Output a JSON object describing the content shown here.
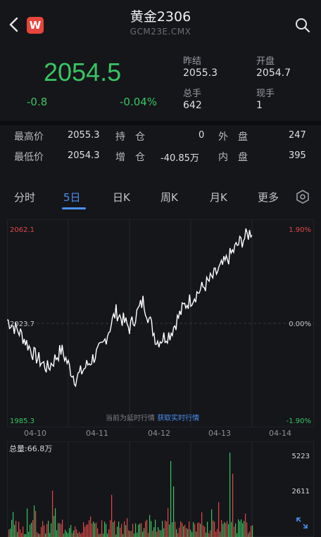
{
  "header": {
    "title": "黄金2306",
    "subtitle": "GCM23E.CMX",
    "logo_text": "W",
    "back_icon": "chevron-left-icon",
    "search_icon": "search-icon"
  },
  "quote": {
    "price": "2054.5",
    "change": "-0.8",
    "change_pct": "-0.04%",
    "prev_settle_label": "昨结",
    "prev_settle": "2055.3",
    "open_label": "开盘",
    "open": "2054.7",
    "total_vol_label": "总手",
    "total_vol": "642",
    "current_vol_label": "现手",
    "current_vol": "1"
  },
  "stats": {
    "high_label": "最高价",
    "high": "2055.3",
    "hold_label": "持　仓",
    "hold": "0",
    "outer_label": "外　盘",
    "outer": "247",
    "low_label": "最低价",
    "low": "2054.3",
    "inc_label": "增　仓",
    "inc": "-40.85万",
    "inner_label": "内　盘",
    "inner": "395"
  },
  "tabs": [
    "分时",
    "5日",
    "日K",
    "周K",
    "月K",
    "更多"
  ],
  "active_tab": "5日",
  "chart_labels": {
    "ymax": "2062.1",
    "ymid": "2023.7",
    "ymin": "1985.3",
    "pmax": "1.90%",
    "pmid": "0.00%",
    "pmin": "-1.90%",
    "dates": [
      "04-10",
      "04-11",
      "04-12",
      "04-13",
      "04-14"
    ],
    "notice": "当前为延时行情",
    "notice_link": "获取实时行情",
    "volume_label": "总量:66.8万",
    "vol_max": "5223",
    "vol_mid": "2611"
  },
  "chart_data": {
    "type": "line",
    "x": [
      "04-10",
      "04-10",
      "04-10",
      "04-10",
      "04-10",
      "04-11",
      "04-11",
      "04-11",
      "04-11",
      "04-11",
      "04-12",
      "04-12",
      "04-12",
      "04-12",
      "04-12",
      "04-13",
      "04-13",
      "04-13",
      "04-13"
    ],
    "values": [
      2025,
      2020,
      2012,
      2007,
      2014,
      2003,
      2009,
      2015,
      2028,
      2022,
      2032,
      2017,
      2020,
      2030,
      2035,
      2040,
      2046,
      2053,
      2058
    ],
    "ylim": [
      1985.3,
      2062.1
    ],
    "volume_ylim": [
      0,
      5223
    ]
  },
  "colors": {
    "up": "#e04848",
    "down": "#39c463",
    "accent": "#4a8ff0",
    "line": "#ffffff"
  }
}
